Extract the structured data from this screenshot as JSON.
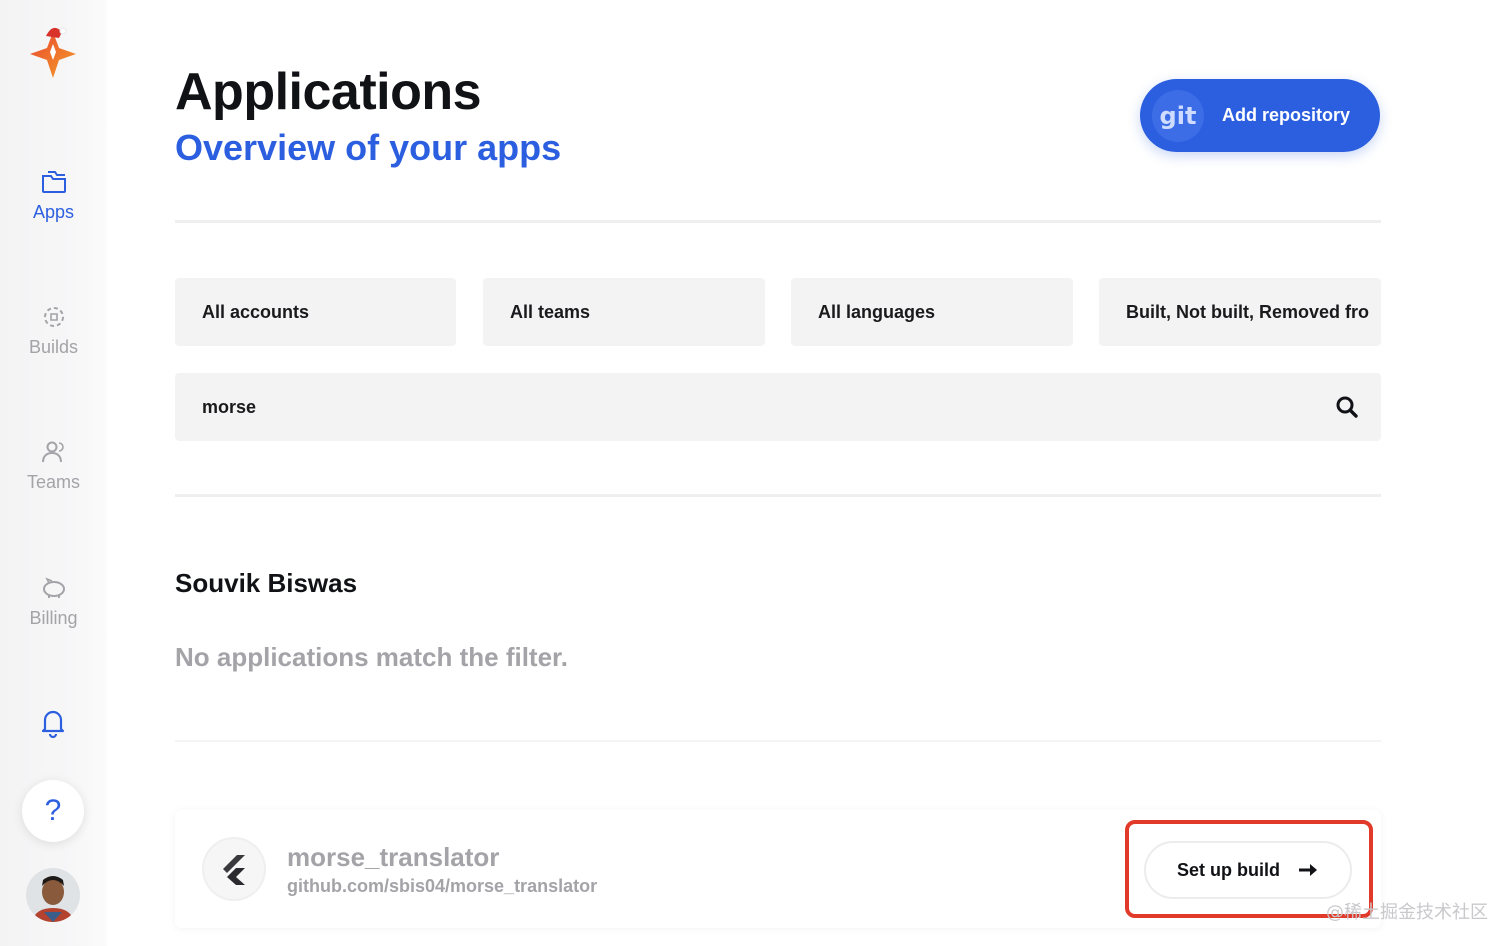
{
  "sidebar": {
    "items": [
      {
        "label": "Apps",
        "icon": "folder-icon",
        "active": true
      },
      {
        "label": "Builds",
        "icon": "builds-icon",
        "active": false
      },
      {
        "label": "Teams",
        "icon": "teams-icon",
        "active": false
      },
      {
        "label": "Billing",
        "icon": "piggy-bank-icon",
        "active": false
      }
    ],
    "help_label": "?"
  },
  "header": {
    "title": "Applications",
    "subtitle": "Overview of your apps",
    "add_repo_badge": "git",
    "add_repo_label": "Add repository"
  },
  "filters": {
    "accounts": "All accounts",
    "teams": "All teams",
    "languages": "All languages",
    "status": "Built, Not built, Removed fro"
  },
  "search": {
    "value": "morse"
  },
  "section": {
    "owner": "Souvik Biswas",
    "empty_message": "No applications match the filter."
  },
  "app": {
    "name": "morse_translator",
    "repo": "github.com/sbis04/morse_translator",
    "action_label": "Set up build"
  },
  "watermark": "@稀土掘金技术社区",
  "colors": {
    "accent": "#2c5fe0",
    "highlight": "#e23a2a",
    "muted": "#a3a3a8"
  }
}
